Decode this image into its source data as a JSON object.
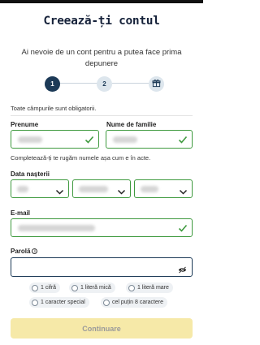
{
  "title": "Creează-ți contul",
  "subtitle": "Ai nevoie de un cont pentru a putea face prima depunere",
  "stepper": {
    "steps": [
      {
        "label": "1",
        "state": "active"
      },
      {
        "label": "2",
        "state": "idle"
      },
      {
        "label": "",
        "icon": "gift-icon",
        "state": "idle"
      }
    ]
  },
  "required_note": "Toate câmpurile sunt obligatorii.",
  "first_name": {
    "label": "Prenume",
    "status": "valid"
  },
  "last_name": {
    "label": "Nume de familie",
    "status": "valid"
  },
  "name_helper": "Completează-ți te rugăm numele așa cum e în acte.",
  "birth_date": {
    "label": "Data nașterii",
    "selects": [
      "day",
      "month",
      "year"
    ]
  },
  "email": {
    "label": "E-mail",
    "status": "valid"
  },
  "password": {
    "label": "Parolă",
    "value": "",
    "toggle_icon": "eye-slash-icon"
  },
  "password_rules": [
    "1 cifră",
    "1 literă mică",
    "1 literă mare",
    "1 caracter special",
    "cel puțin 8 caractere"
  ],
  "continue_label": "Continuare",
  "colors": {
    "primary": "#1c3a57",
    "valid_border": "#3f9a3f",
    "button_disabled_bg": "#f6e9a8",
    "chip_bg": "#eef1f4"
  }
}
